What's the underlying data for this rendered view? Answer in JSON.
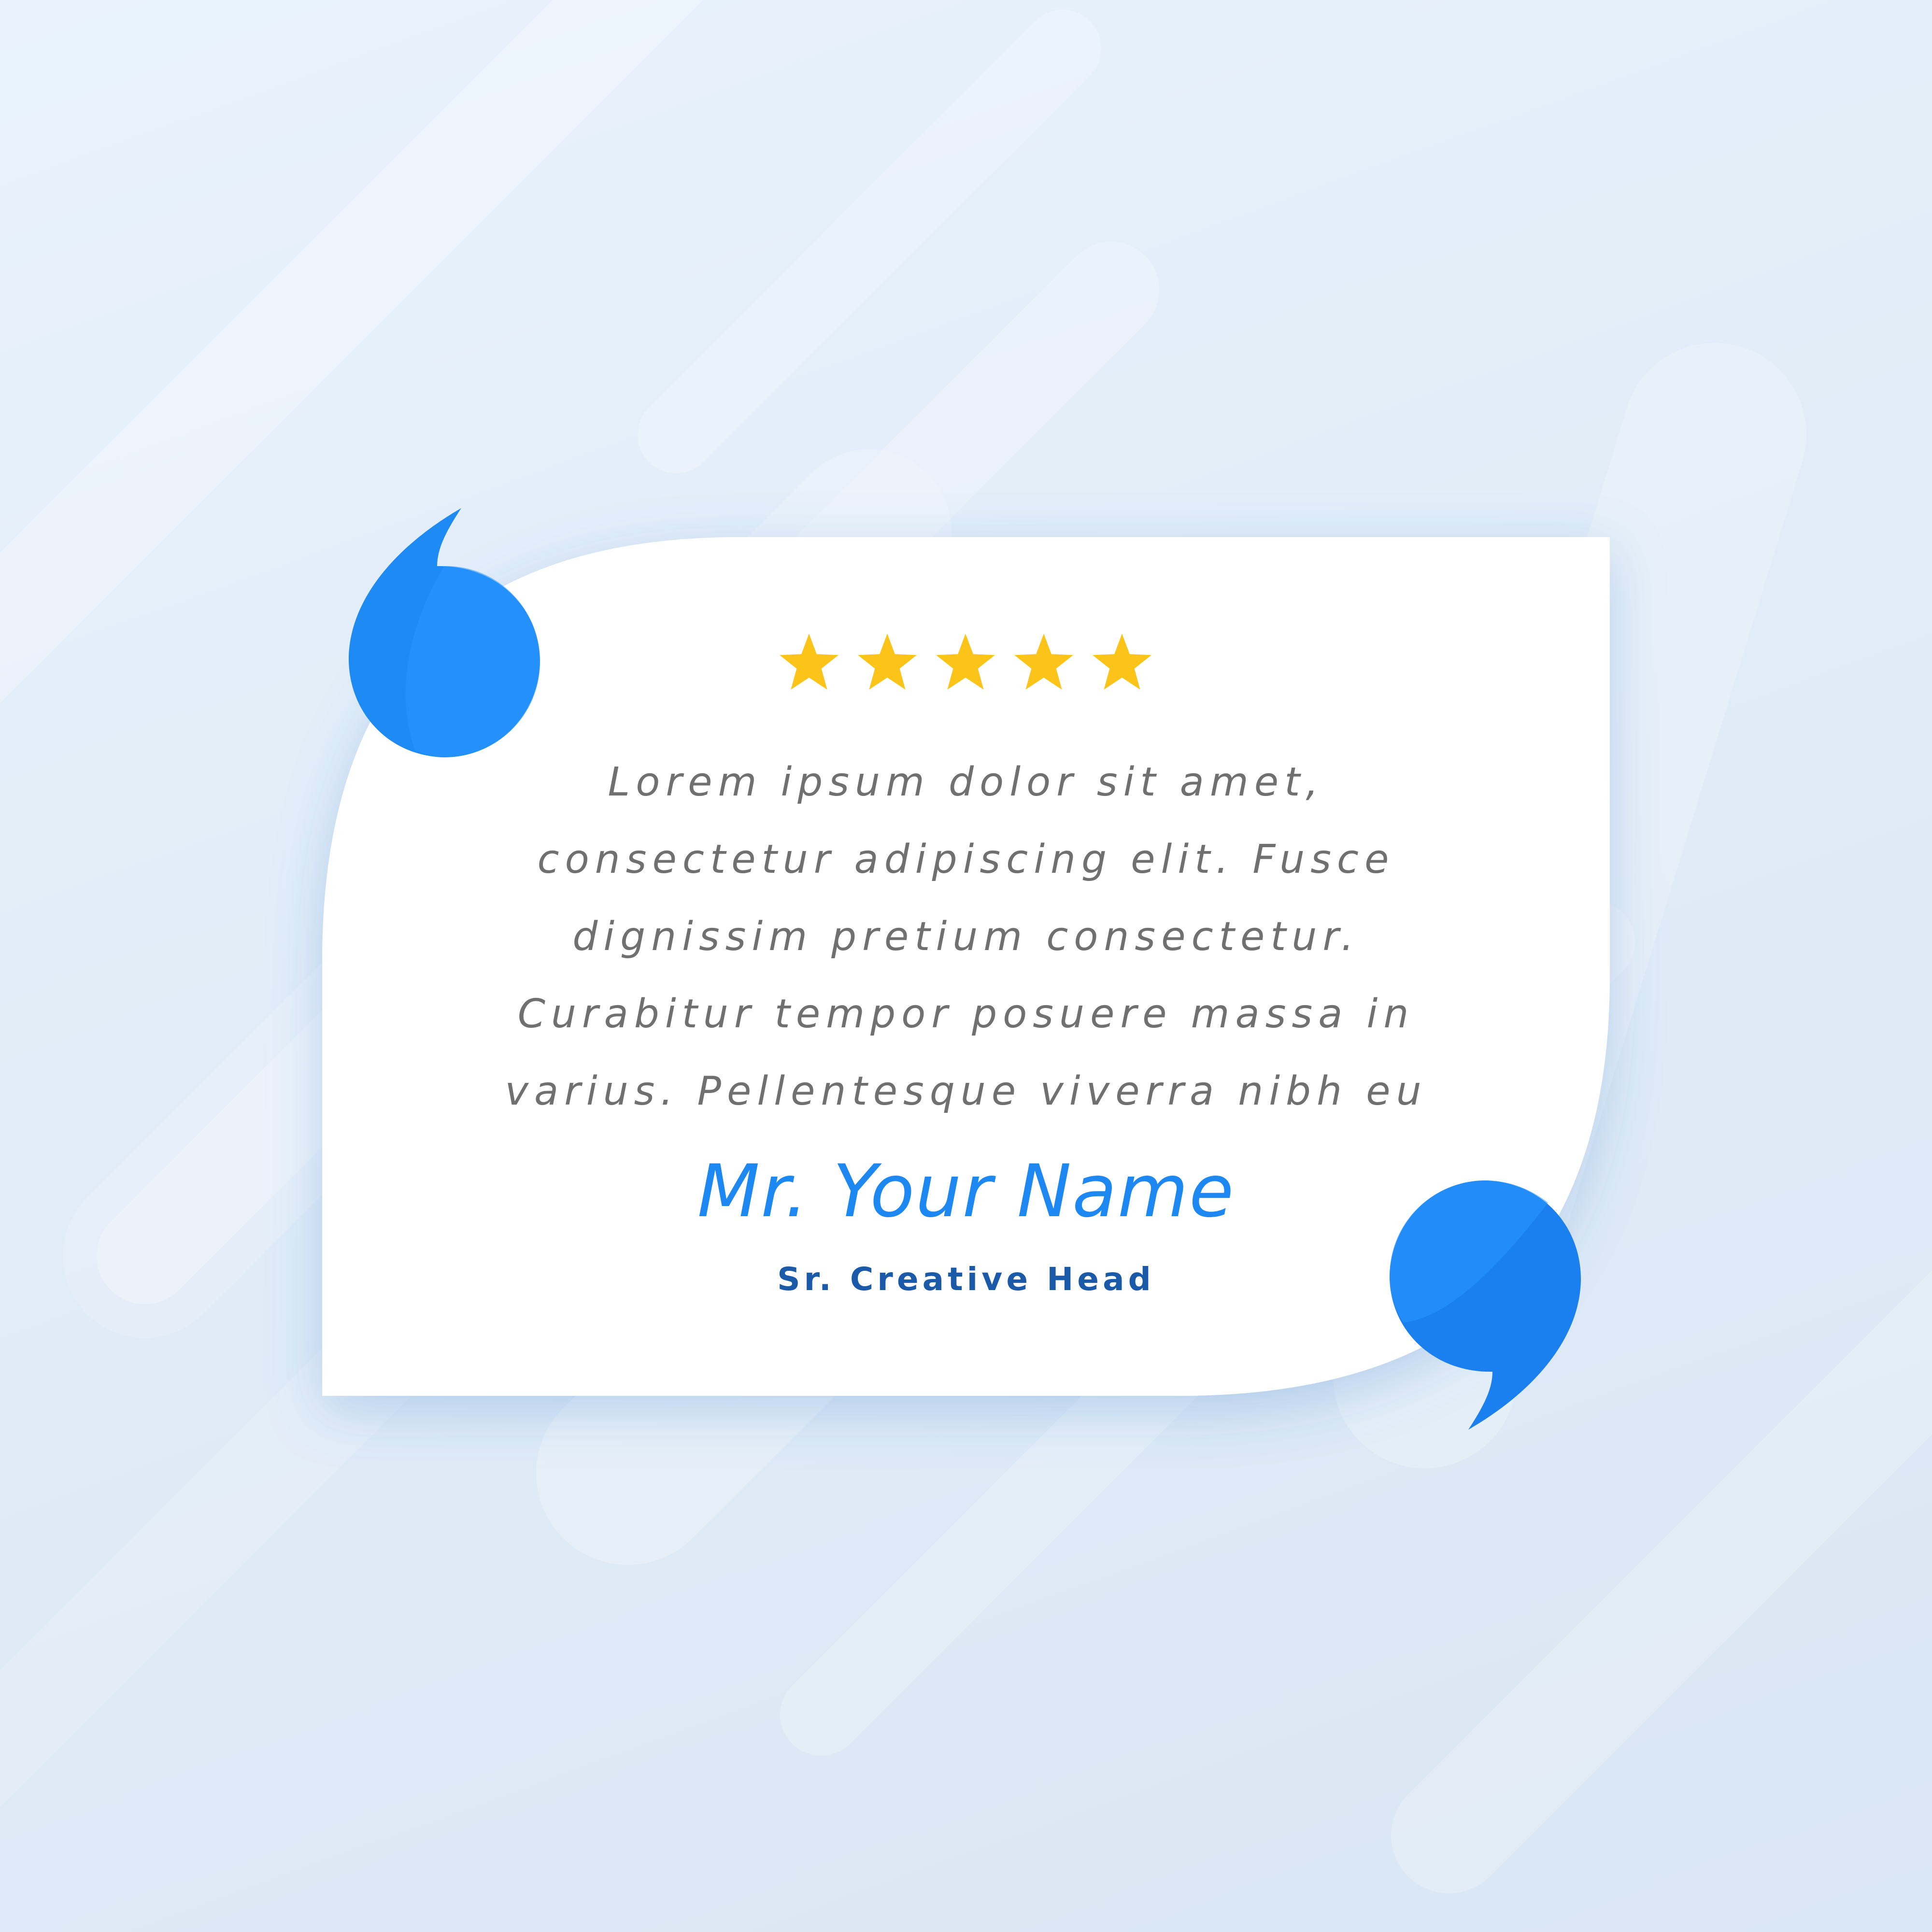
{
  "testimonial": {
    "rating": 5,
    "rating_max": 5,
    "quote_lines": [
      "Lorem ipsum dolor sit amet,",
      "consectetur adipiscing elit. Fusce",
      "dignissim pretium consectetur.",
      "Curabitur tempor posuere massa in",
      "varius. Pellentesque viverra nibh eu"
    ],
    "name": "Mr. Your Name",
    "role": "Sr. Creative Head"
  },
  "icons": {
    "open_quote": "open-quote-icon",
    "close_quote": "close-quote-icon",
    "star": "star-icon"
  },
  "colors": {
    "accent_blue": "#1e88f2",
    "accent_blue_dark": "#1a80f0",
    "role_blue": "#1a5aa8",
    "star_gold": "#fcc419",
    "text_gray": "#707070",
    "card_white": "#ffffff",
    "background": "#e4eef9"
  }
}
